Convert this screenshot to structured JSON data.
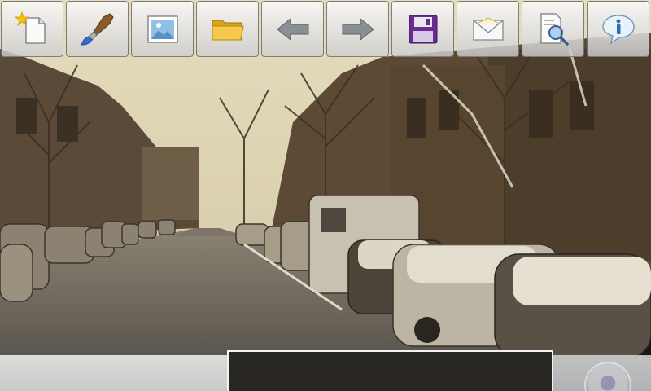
{
  "toolbar": {
    "buttons": [
      {
        "id": "new",
        "icon": "new-document-icon"
      },
      {
        "id": "brush",
        "icon": "paintbrush-icon"
      },
      {
        "id": "image",
        "icon": "picture-icon"
      },
      {
        "id": "open",
        "icon": "folder-icon"
      },
      {
        "id": "back",
        "icon": "arrow-left-icon"
      },
      {
        "id": "forward",
        "icon": "arrow-right-icon"
      },
      {
        "id": "save",
        "icon": "floppy-disk-icon"
      },
      {
        "id": "mail",
        "icon": "envelope-icon"
      },
      {
        "id": "zoom",
        "icon": "document-search-icon"
      },
      {
        "id": "info",
        "icon": "info-icon"
      }
    ]
  },
  "photo": {
    "description_visible": false,
    "tone": "sepia"
  },
  "colors": {
    "sky": "#e8dfc0",
    "road": "#5f5a52",
    "snow": "#d8d2c4",
    "info_blue": "#2b6cb0",
    "save_purple": "#6a2c91",
    "folder_yellow": "#f2c33a"
  }
}
